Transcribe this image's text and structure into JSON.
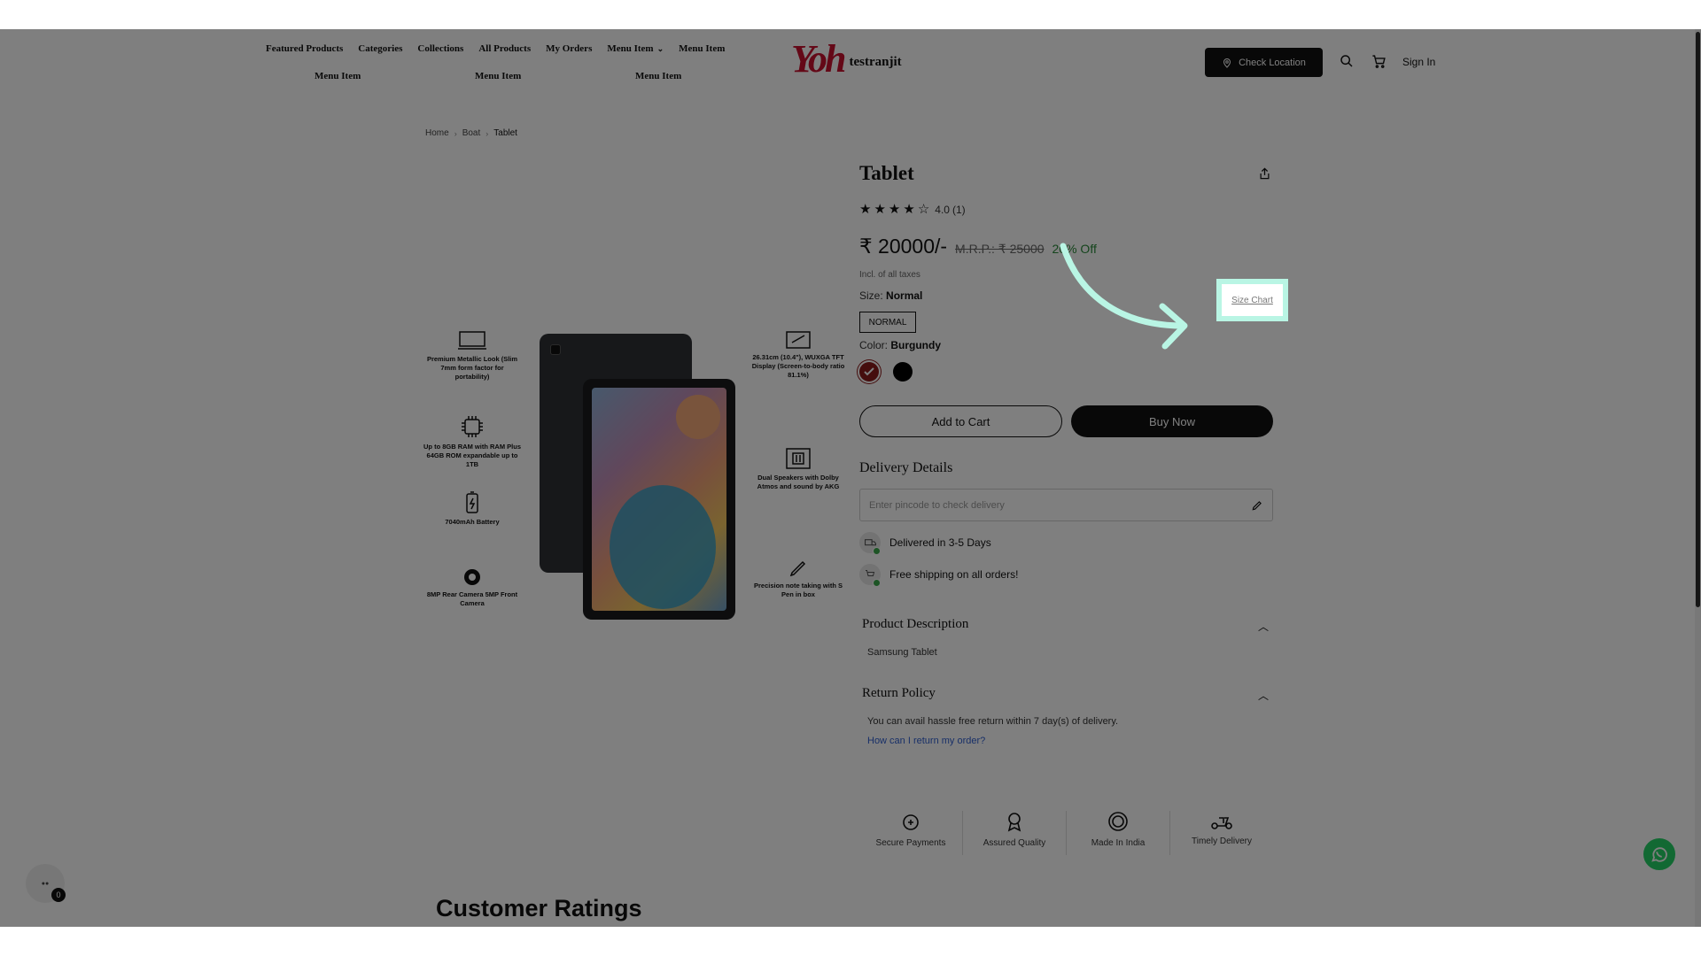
{
  "header": {
    "nav_row1": [
      "Featured Products",
      "Categories",
      "Collections",
      "All Products",
      "My Orders",
      "Menu Item",
      "Menu Item"
    ],
    "nav_row2": [
      "Menu Item",
      "Menu Item",
      "Menu Item"
    ],
    "logo_text": "testranjit",
    "logo_mark": "Yoh",
    "check_location": "Check Location",
    "sign_in": "Sign In"
  },
  "breadcrumb": [
    "Home",
    "Boat",
    "Tablet"
  ],
  "product": {
    "features_left": [
      "Premium Metallic Look (Slim 7mm form factor for portability)",
      "Up to 8GB RAM with RAM Plus 64GB ROM expandable up to 1TB",
      "7040mAh Battery",
      "8MP Rear Camera 5MP Front Camera"
    ],
    "features_right": [
      "26.31cm (10.4\"), WUXGA TFT Display (Screen-to-body ratio 81.1%)",
      "Dual Speakers with Dolby Atmos and sound by AKG",
      "Precision note taking with S Pen in box"
    ],
    "title": "Tablet",
    "rating_value": "4.0",
    "rating_count": "(1)",
    "rating_stars": 4,
    "price": "₹ 20000/-",
    "mrp": "M.R.P.: ₹ 25000",
    "discount": "20% Off",
    "taxes": "Incl. of all taxes",
    "size_prefix": "Size:",
    "size_value": "Normal",
    "size_chart": "Size Chart",
    "size_option": "NORMAL",
    "color_prefix": "Color:",
    "color_value": "Burgundy",
    "colors": [
      "#8b1a1a",
      "#000000"
    ],
    "add_to_cart": "Add to Cart",
    "buy_now": "Buy Now"
  },
  "delivery": {
    "title": "Delivery Details",
    "pincode_placeholder": "Enter pincode to check delivery",
    "items": [
      "Delivered in 3-5 Days",
      "Free shipping on all orders!"
    ]
  },
  "description": {
    "title": "Product Description",
    "body": "Samsung Tablet"
  },
  "return_policy": {
    "title": "Return Policy",
    "body": "You can avail hassle free return within 7 day(s) of delivery.",
    "link": "How can I return my order?"
  },
  "badges": [
    "Secure Payments",
    "Assured Quality",
    "Made In India",
    "Timely Delivery"
  ],
  "customer_ratings_title": "Customer Ratings",
  "chat_badge_count": "0",
  "colors": {
    "highlight_border": "#b9f5e4",
    "discount_green": "#2a8a3a",
    "link_blue": "#2f5fd0"
  }
}
